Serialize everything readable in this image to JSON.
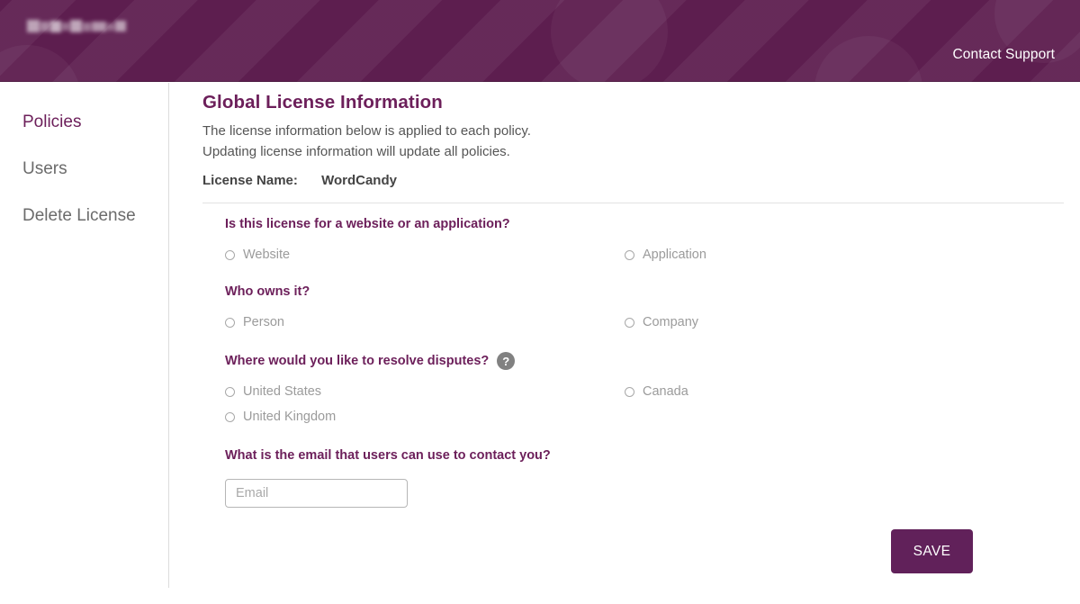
{
  "brand": {
    "header_bg": "#5d1e4f",
    "accent": "#6c1f5a",
    "save_bg": "#61215a",
    "logo_alt": "redacted-logo"
  },
  "header": {
    "contact_support": "Contact Support"
  },
  "sidebar": {
    "items": [
      {
        "label": "Policies",
        "active": true
      },
      {
        "label": "Users",
        "active": false
      },
      {
        "label": "Delete License",
        "active": false
      }
    ]
  },
  "main": {
    "title": "Global License Information",
    "intro_line_1": "The license information below is applied to each policy.",
    "intro_line_2": "Updating license information will update all policies.",
    "license_name_label": "License Name:",
    "license_name_value": "WordCandy",
    "questions": [
      {
        "title": "Is this license for a website or an application?",
        "options": [
          "Website",
          "Application"
        ],
        "help": false
      },
      {
        "title": "Who owns it?",
        "options": [
          "Person",
          "Company"
        ],
        "help": false
      },
      {
        "title": "Where would you like to resolve disputes?",
        "options": [
          "United States",
          "Canada",
          "United Kingdom"
        ],
        "help": true,
        "help_glyph": "?"
      },
      {
        "title": "What is the email that users can use to contact you?",
        "options": [],
        "help": false
      }
    ],
    "email_field": {
      "placeholder": "Email",
      "value": ""
    },
    "save_label": "SAVE"
  }
}
